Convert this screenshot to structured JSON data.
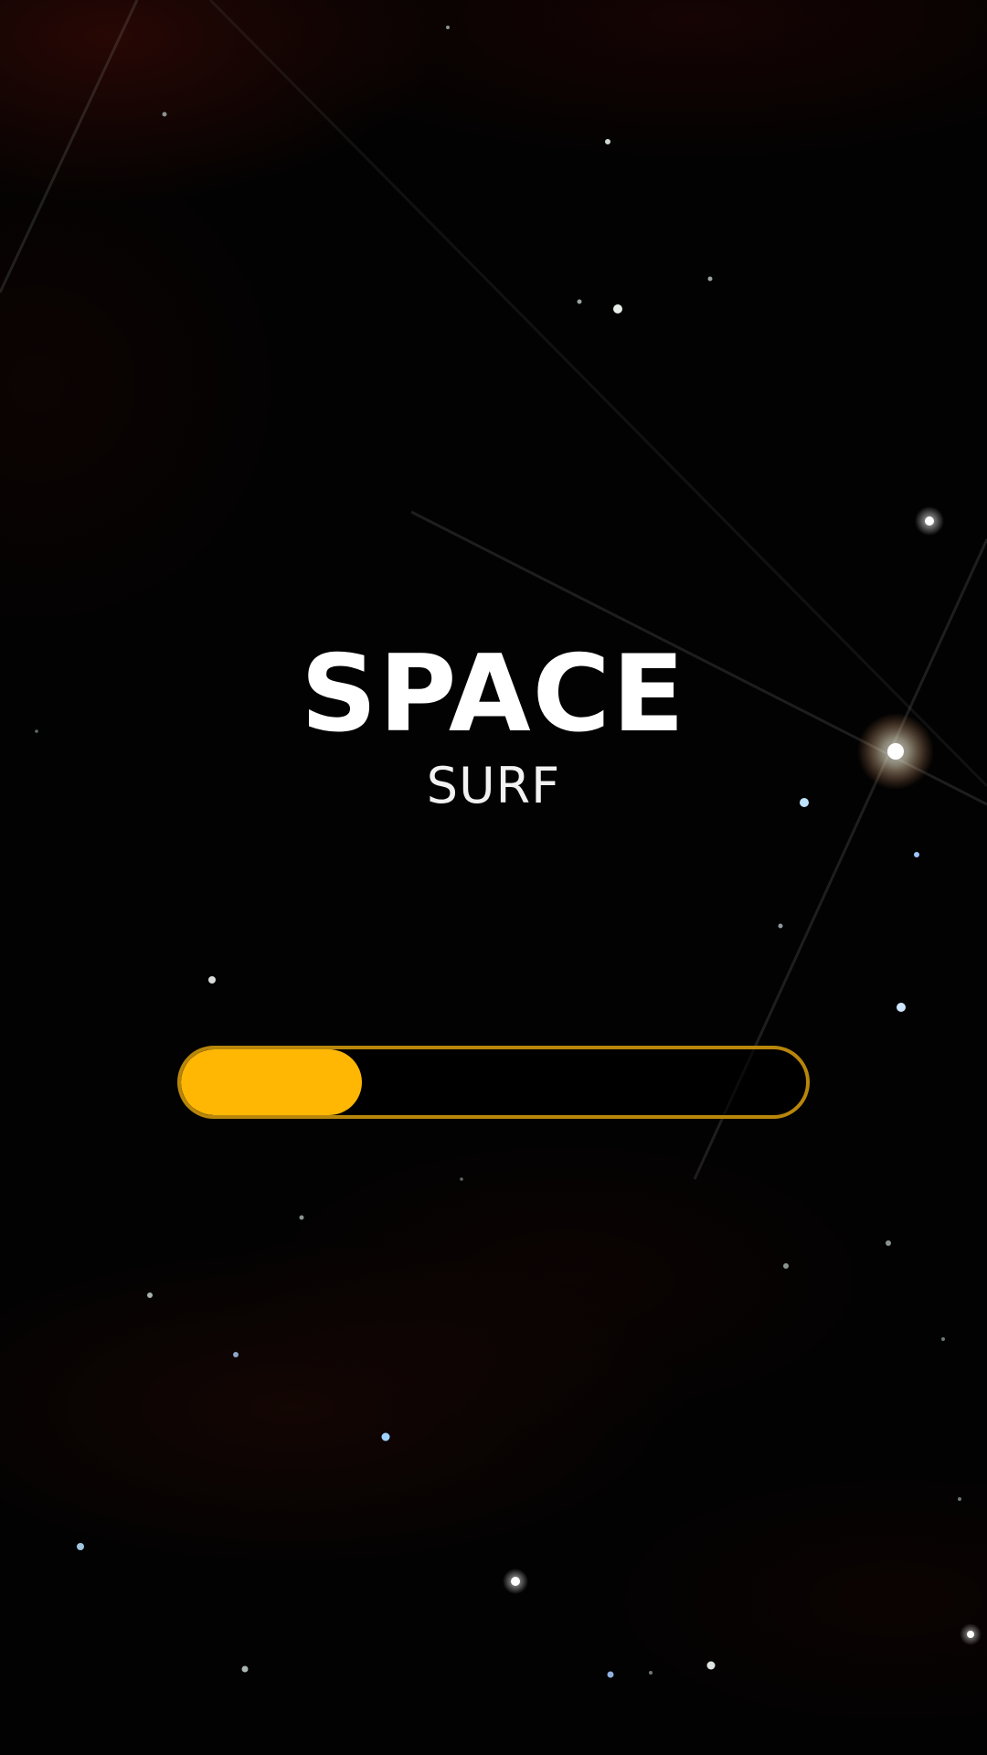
{
  "app": {
    "title": "SPACE",
    "subtitle": "SURF"
  },
  "loading": {
    "progress": 0.29
  },
  "colors": {
    "background": "#020202",
    "title": "#ffffff",
    "progress_fill": "#ffb703",
    "progress_border": "#b8860b"
  }
}
